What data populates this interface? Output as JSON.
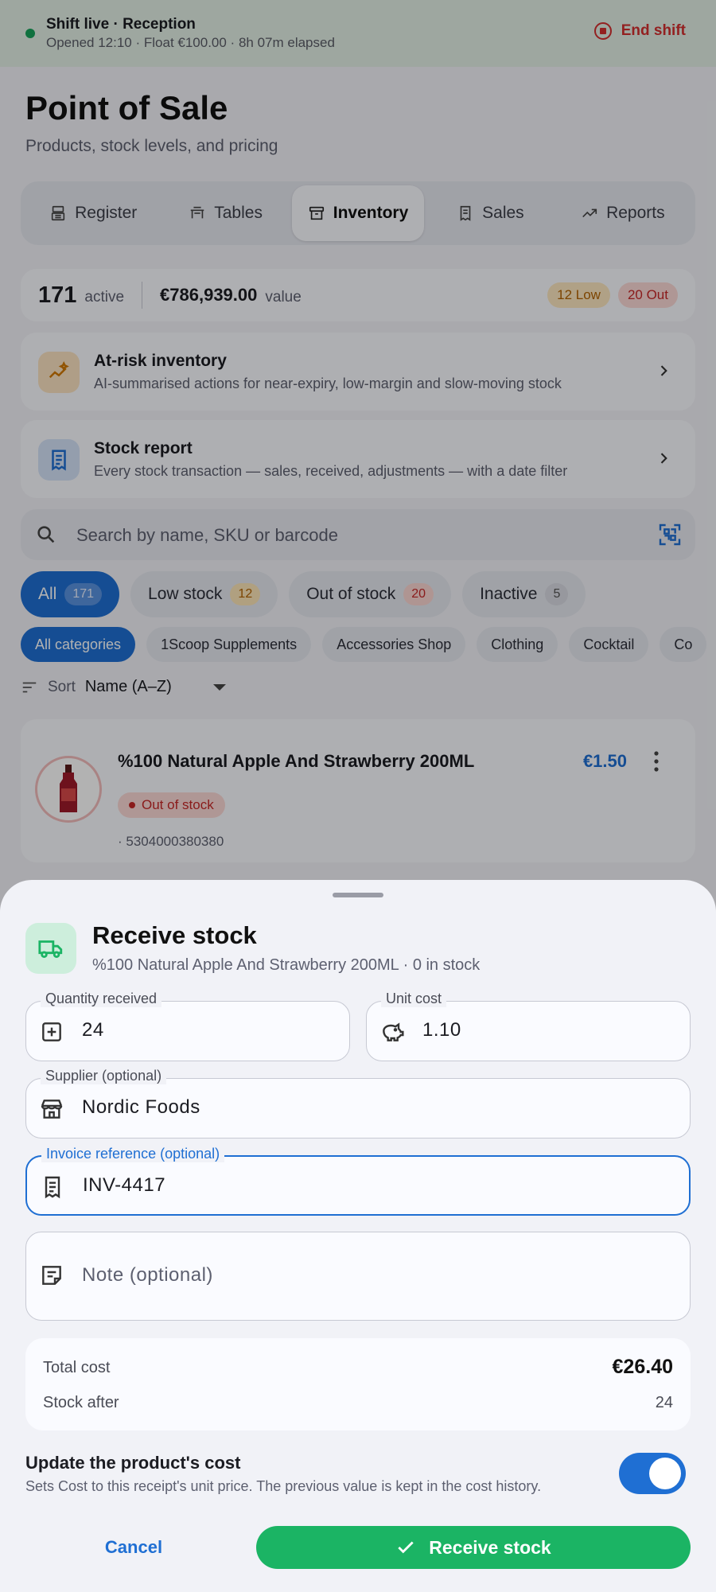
{
  "shift": {
    "title": "Shift live · Reception",
    "subtitle": "Opened 12:10 · Float €100.00 · 8h 07m elapsed",
    "end_label": "End shift"
  },
  "page": {
    "title": "Point of Sale",
    "subtitle": "Products, stock levels, and pricing"
  },
  "tabs": [
    {
      "label": "Register",
      "icon": "register-icon"
    },
    {
      "label": "Tables",
      "icon": "table-icon"
    },
    {
      "label": "Inventory",
      "icon": "archive-icon",
      "active": true
    },
    {
      "label": "Sales",
      "icon": "receipt-icon"
    },
    {
      "label": "Reports",
      "icon": "trend-icon"
    }
  ],
  "summary": {
    "active_count": "171",
    "active_label": "active",
    "value": "€786,939.00",
    "value_label": "value",
    "low": "12 Low",
    "out": "20 Out"
  },
  "cards": {
    "at_risk": {
      "title": "At-risk inventory",
      "subtitle": "AI-summarised actions for near-expiry, low-margin and slow-moving stock"
    },
    "stock_report": {
      "title": "Stock report",
      "subtitle": "Every stock transaction — sales, received, adjustments — with a date filter"
    }
  },
  "search": {
    "placeholder": "Search by name, SKU or barcode"
  },
  "filters": [
    {
      "label": "All",
      "count": "171"
    },
    {
      "label": "Low stock",
      "count": "12"
    },
    {
      "label": "Out of stock",
      "count": "20"
    },
    {
      "label": "Inactive",
      "count": "5"
    }
  ],
  "categories": [
    "All categories",
    "1Scoop Supplements",
    "Accessories Shop",
    "Clothing",
    "Cocktail",
    "Co"
  ],
  "sort": {
    "label": "Sort",
    "value": "Name (A–Z)"
  },
  "product": {
    "name": "%100 Natural Apple And Strawberry 200ML",
    "price": "€1.50",
    "badge": "Out of stock",
    "sku": "· 5304000380380"
  },
  "sheet": {
    "title": "Receive stock",
    "subtitle": "%100 Natural Apple And Strawberry 200ML · 0 in stock",
    "quantity": {
      "label": "Quantity received",
      "value": "24"
    },
    "unit_cost": {
      "label": "Unit cost",
      "value": "1.10"
    },
    "supplier": {
      "label": "Supplier (optional)",
      "value": "Nordic Foods"
    },
    "invoice": {
      "label": "Invoice reference (optional)",
      "value": "INV-4417"
    },
    "note": {
      "placeholder": "Note (optional)"
    },
    "totals": {
      "total_label": "Total cost",
      "total_value": "€26.40",
      "after_label": "Stock after",
      "after_value": "24"
    },
    "update": {
      "title": "Update the product's cost",
      "subtitle": "Sets Cost to this receipt's unit price. The previous value is kept in the cost history.",
      "enabled": true
    },
    "cancel_label": "Cancel",
    "receive_label": "Receive stock"
  },
  "colors": {
    "accent": "#1f6fd3",
    "success": "#1bb464",
    "danger": "#d32f2f",
    "warning": "#b26200"
  }
}
